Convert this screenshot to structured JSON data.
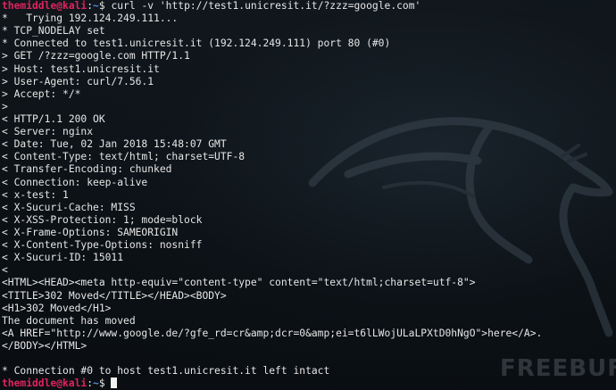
{
  "terminal": {
    "prompt": {
      "user_host": "themiddle@kali",
      "separator": ":",
      "path": "~",
      "symbol": "$"
    },
    "command": " curl -v 'http://test1.unicresit.it/?zzz=google.com'",
    "output": [
      "*   Trying 192.124.249.111...",
      "* TCP_NODELAY set",
      "* Connected to test1.unicresit.it (192.124.249.111) port 80 (#0)",
      "> GET /?zzz=google.com HTTP/1.1",
      "> Host: test1.unicresit.it",
      "> User-Agent: curl/7.56.1",
      "> Accept: */*",
      ">",
      "< HTTP/1.1 200 OK",
      "< Server: nginx",
      "< Date: Tue, 02 Jan 2018 15:48:07 GMT",
      "< Content-Type: text/html; charset=UTF-8",
      "< Transfer-Encoding: chunked",
      "< Connection: keep-alive",
      "< x-test: 1",
      "< X-Sucuri-Cache: MISS",
      "< X-XSS-Protection: 1; mode=block",
      "< X-Frame-Options: SAMEORIGIN",
      "< X-Content-Type-Options: nosniff",
      "< X-Sucuri-ID: 15011",
      "<",
      "<HTML><HEAD><meta http-equiv=\"content-type\" content=\"text/html;charset=utf-8\">",
      "<TITLE>302 Moved</TITLE></HEAD><BODY>",
      "<H1>302 Moved</H1>",
      "The document has moved",
      "<A HREF=\"http://www.google.de/?gfe_rd=cr&amp;dcr=0&amp;ei=t6lLWojULaLPXtD0hNgO\">here</A>.",
      "</BODY></HTML>",
      "",
      "* Connection #0 to host test1.unicresit.it left intact"
    ],
    "final_command": " "
  },
  "watermark": "FREEBUF",
  "colors": {
    "background": "#0b1014",
    "text": "#e6e6e6",
    "prompt_user": "#e0245e",
    "prompt_path": "#4e8ce4"
  }
}
